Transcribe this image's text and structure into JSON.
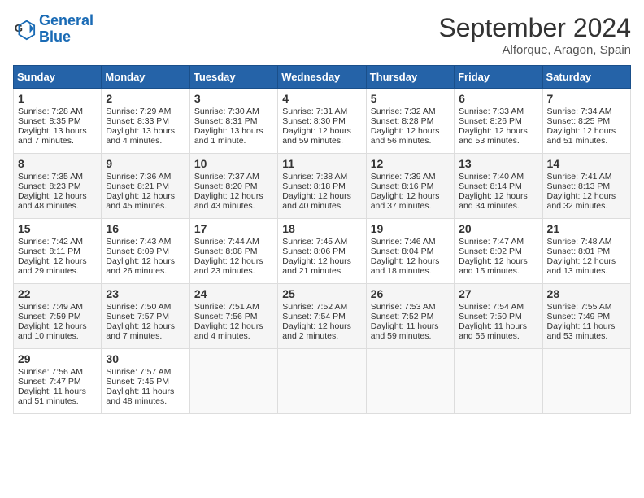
{
  "header": {
    "logo_line1": "General",
    "logo_line2": "Blue",
    "month": "September 2024",
    "location": "Alforque, Aragon, Spain"
  },
  "days_of_week": [
    "Sunday",
    "Monday",
    "Tuesday",
    "Wednesday",
    "Thursday",
    "Friday",
    "Saturday"
  ],
  "weeks": [
    [
      {
        "day": "1",
        "info": "Sunrise: 7:28 AM\nSunset: 8:35 PM\nDaylight: 13 hours\nand 7 minutes."
      },
      {
        "day": "2",
        "info": "Sunrise: 7:29 AM\nSunset: 8:33 PM\nDaylight: 13 hours\nand 4 minutes."
      },
      {
        "day": "3",
        "info": "Sunrise: 7:30 AM\nSunset: 8:31 PM\nDaylight: 13 hours\nand 1 minute."
      },
      {
        "day": "4",
        "info": "Sunrise: 7:31 AM\nSunset: 8:30 PM\nDaylight: 12 hours\nand 59 minutes."
      },
      {
        "day": "5",
        "info": "Sunrise: 7:32 AM\nSunset: 8:28 PM\nDaylight: 12 hours\nand 56 minutes."
      },
      {
        "day": "6",
        "info": "Sunrise: 7:33 AM\nSunset: 8:26 PM\nDaylight: 12 hours\nand 53 minutes."
      },
      {
        "day": "7",
        "info": "Sunrise: 7:34 AM\nSunset: 8:25 PM\nDaylight: 12 hours\nand 51 minutes."
      }
    ],
    [
      {
        "day": "8",
        "info": "Sunrise: 7:35 AM\nSunset: 8:23 PM\nDaylight: 12 hours\nand 48 minutes."
      },
      {
        "day": "9",
        "info": "Sunrise: 7:36 AM\nSunset: 8:21 PM\nDaylight: 12 hours\nand 45 minutes."
      },
      {
        "day": "10",
        "info": "Sunrise: 7:37 AM\nSunset: 8:20 PM\nDaylight: 12 hours\nand 43 minutes."
      },
      {
        "day": "11",
        "info": "Sunrise: 7:38 AM\nSunset: 8:18 PM\nDaylight: 12 hours\nand 40 minutes."
      },
      {
        "day": "12",
        "info": "Sunrise: 7:39 AM\nSunset: 8:16 PM\nDaylight: 12 hours\nand 37 minutes."
      },
      {
        "day": "13",
        "info": "Sunrise: 7:40 AM\nSunset: 8:14 PM\nDaylight: 12 hours\nand 34 minutes."
      },
      {
        "day": "14",
        "info": "Sunrise: 7:41 AM\nSunset: 8:13 PM\nDaylight: 12 hours\nand 32 minutes."
      }
    ],
    [
      {
        "day": "15",
        "info": "Sunrise: 7:42 AM\nSunset: 8:11 PM\nDaylight: 12 hours\nand 29 minutes."
      },
      {
        "day": "16",
        "info": "Sunrise: 7:43 AM\nSunset: 8:09 PM\nDaylight: 12 hours\nand 26 minutes."
      },
      {
        "day": "17",
        "info": "Sunrise: 7:44 AM\nSunset: 8:08 PM\nDaylight: 12 hours\nand 23 minutes."
      },
      {
        "day": "18",
        "info": "Sunrise: 7:45 AM\nSunset: 8:06 PM\nDaylight: 12 hours\nand 21 minutes."
      },
      {
        "day": "19",
        "info": "Sunrise: 7:46 AM\nSunset: 8:04 PM\nDaylight: 12 hours\nand 18 minutes."
      },
      {
        "day": "20",
        "info": "Sunrise: 7:47 AM\nSunset: 8:02 PM\nDaylight: 12 hours\nand 15 minutes."
      },
      {
        "day": "21",
        "info": "Sunrise: 7:48 AM\nSunset: 8:01 PM\nDaylight: 12 hours\nand 13 minutes."
      }
    ],
    [
      {
        "day": "22",
        "info": "Sunrise: 7:49 AM\nSunset: 7:59 PM\nDaylight: 12 hours\nand 10 minutes."
      },
      {
        "day": "23",
        "info": "Sunrise: 7:50 AM\nSunset: 7:57 PM\nDaylight: 12 hours\nand 7 minutes."
      },
      {
        "day": "24",
        "info": "Sunrise: 7:51 AM\nSunset: 7:56 PM\nDaylight: 12 hours\nand 4 minutes."
      },
      {
        "day": "25",
        "info": "Sunrise: 7:52 AM\nSunset: 7:54 PM\nDaylight: 12 hours\nand 2 minutes."
      },
      {
        "day": "26",
        "info": "Sunrise: 7:53 AM\nSunset: 7:52 PM\nDaylight: 11 hours\nand 59 minutes."
      },
      {
        "day": "27",
        "info": "Sunrise: 7:54 AM\nSunset: 7:50 PM\nDaylight: 11 hours\nand 56 minutes."
      },
      {
        "day": "28",
        "info": "Sunrise: 7:55 AM\nSunset: 7:49 PM\nDaylight: 11 hours\nand 53 minutes."
      }
    ],
    [
      {
        "day": "29",
        "info": "Sunrise: 7:56 AM\nSunset: 7:47 PM\nDaylight: 11 hours\nand 51 minutes."
      },
      {
        "day": "30",
        "info": "Sunrise: 7:57 AM\nSunset: 7:45 PM\nDaylight: 11 hours\nand 48 minutes."
      },
      {
        "day": "",
        "info": ""
      },
      {
        "day": "",
        "info": ""
      },
      {
        "day": "",
        "info": ""
      },
      {
        "day": "",
        "info": ""
      },
      {
        "day": "",
        "info": ""
      }
    ]
  ]
}
